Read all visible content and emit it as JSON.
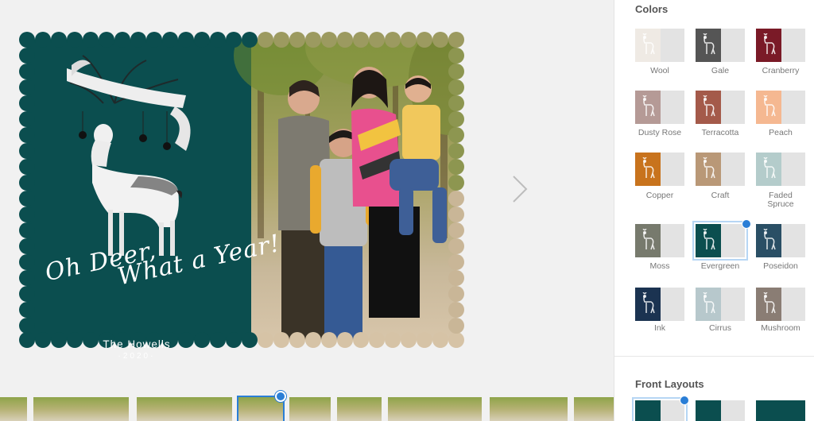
{
  "card": {
    "greeting_line1": "Oh Deer,",
    "greeting_line2": "What a Year!",
    "family_name": "The Howells",
    "year": "·2020·",
    "card_color": "#0b4e4f"
  },
  "panel": {
    "colors_title": "Colors",
    "layouts_title": "Front Layouts",
    "colors": [
      {
        "name": "Wool",
        "hex": "#efeae4"
      },
      {
        "name": "Gale",
        "hex": "#555555"
      },
      {
        "name": "Cranberry",
        "hex": "#7a1a27"
      },
      {
        "name": "Dusty Rose",
        "hex": "#b59a96"
      },
      {
        "name": "Terracotta",
        "hex": "#a45a4a"
      },
      {
        "name": "Peach",
        "hex": "#f5b891"
      },
      {
        "name": "Copper",
        "hex": "#c8731d"
      },
      {
        "name": "Craft",
        "hex": "#b99877"
      },
      {
        "name": "Faded Spruce",
        "hex": "#b4cccb"
      },
      {
        "name": "Moss",
        "hex": "#777a6d"
      },
      {
        "name": "Evergreen",
        "hex": "#0b4e4f",
        "selected": true
      },
      {
        "name": "Poseidon",
        "hex": "#2a4f65"
      },
      {
        "name": "Ink",
        "hex": "#1b3351"
      },
      {
        "name": "Cirrus",
        "hex": "#b7c8cc"
      },
      {
        "name": "Mushroom",
        "hex": "#8a7d74"
      }
    ]
  },
  "accent_color": "#2a7ed6"
}
